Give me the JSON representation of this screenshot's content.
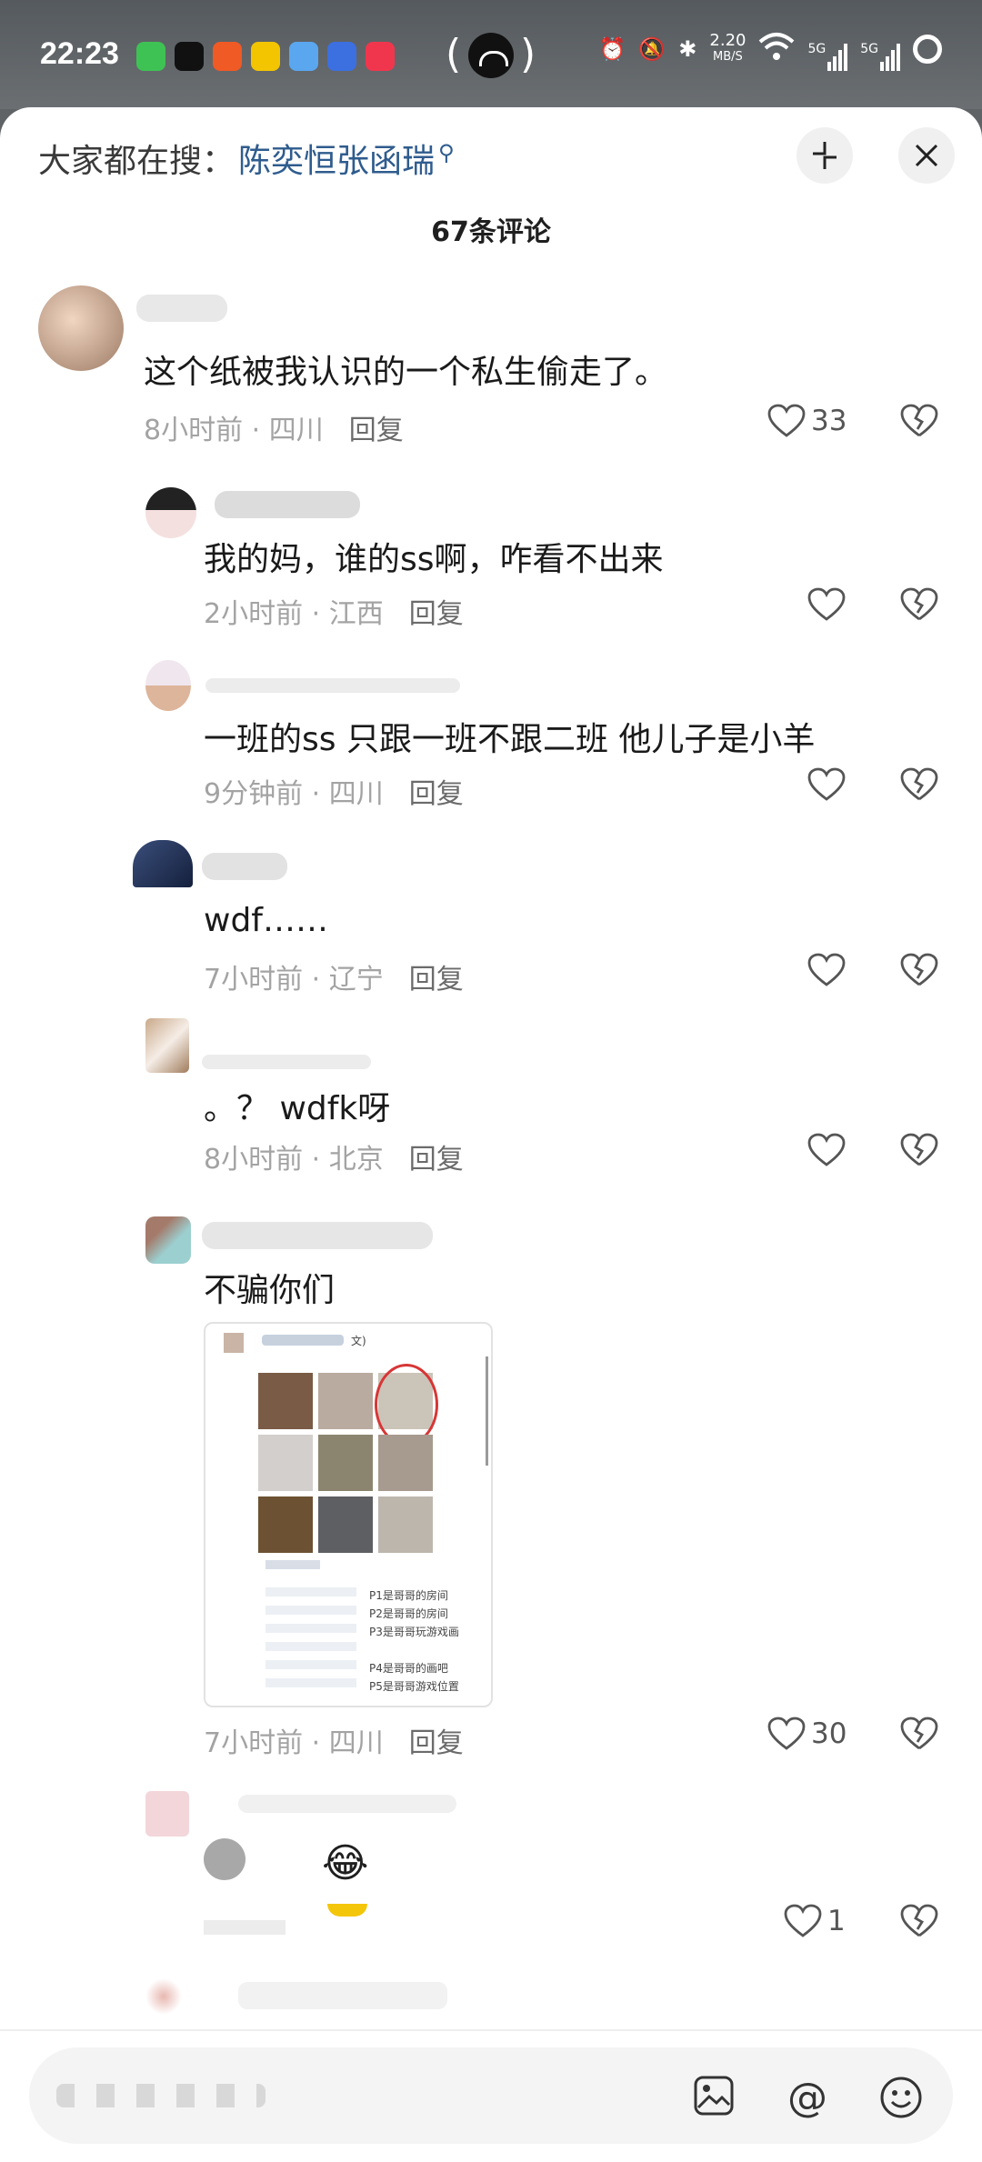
{
  "status_bar": {
    "time": "22:23",
    "net_speed": "2.20",
    "net_unit": "MB/S",
    "signal_1": "5G",
    "signal_2": "5G",
    "center_icon": "fingerprint-icon"
  },
  "header": {
    "search_prefix": "大家都在搜：",
    "search_keyword": "陈奕恒张函瑞",
    "comment_count": "67条评论"
  },
  "comments": [
    {
      "text": "这个纸被我认识的一个私生偷走了。",
      "meta": "8小时前 · 四川",
      "reply": "回复",
      "likes": "33"
    },
    {
      "text": "我的妈，谁的ss啊，咋看不出来",
      "meta": "2小时前 · 江西",
      "reply": "回复",
      "likes": ""
    },
    {
      "text": "一班的ss 只跟一班不跟二班 他儿子是小羊",
      "meta": "9分钟前 · 四川",
      "reply": "回复",
      "likes": ""
    },
    {
      "text": "wdf……",
      "meta": "7小时前 · 辽宁",
      "reply": "回复",
      "likes": ""
    },
    {
      "text": "。？ wdfk呀",
      "meta": "8小时前 · 北京",
      "reply": "回复",
      "likes": ""
    },
    {
      "text": "不骗你们",
      "meta": "7小时前 · 四川",
      "reply": "回复",
      "likes": "30"
    },
    {
      "text": "",
      "meta": "",
      "reply": "",
      "likes": "1"
    }
  ],
  "image_captions": {
    "tag": "文)",
    "p1": "P1是哥哥的房间",
    "p2": "P2是哥哥的房间",
    "p3": "P3是哥哥玩游戏画",
    "p4": "P4是哥哥的画吧",
    "p5": "P5是哥哥游戏位置"
  },
  "input_bar": {
    "placeholder": ""
  },
  "colors": {
    "keyword": "#2f5c8e",
    "meta_gray": "#a3a3a3",
    "sheet_bg": "#ffffff"
  }
}
